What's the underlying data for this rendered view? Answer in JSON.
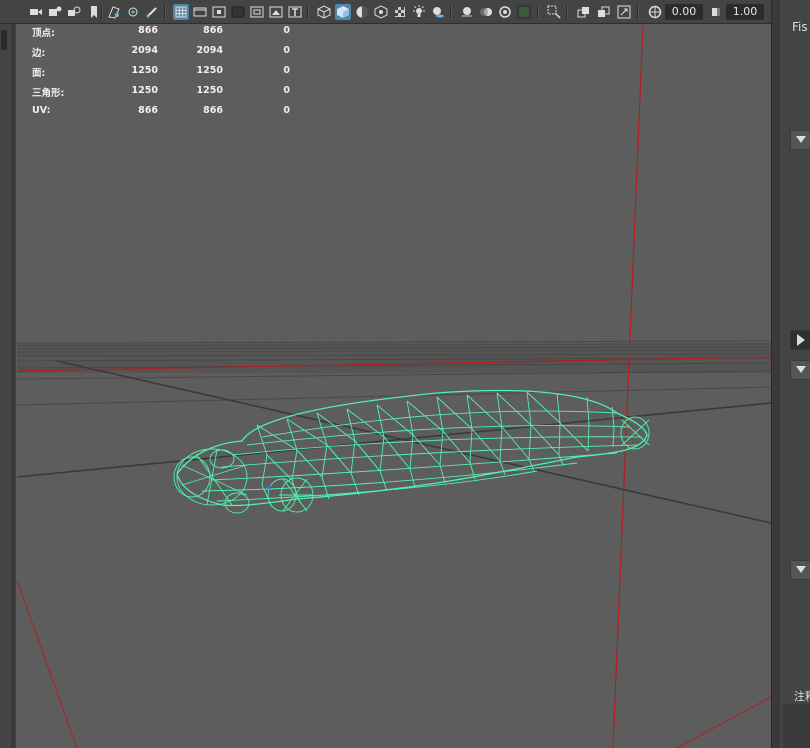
{
  "toolbar": {
    "icons": [
      "camera-icon",
      "camera-attr-icon",
      "bookmark-camera-icon",
      "bookmark-icon",
      "image-plane-icon",
      "grease-pencil-icon",
      "tool-icon",
      "grid-icon",
      "film-gate-icon",
      "resolution-gate-icon",
      "gate-mask-icon",
      "field-chart-icon",
      "safe-action-icon",
      "safe-title-icon",
      "wireframe-icon",
      "smooth-shade-icon",
      "default-material-icon",
      "xray-joint-icon",
      "textured-icon",
      "lighting-icon",
      "shadows-icon",
      "ambient-occlusion-icon",
      "motion-blur-icon",
      "anti-alias-icon",
      "depth-of-field-icon",
      "isolate-icon",
      "xray-icon",
      "xray-active-icon",
      "backface-icon",
      "exposure-icon",
      "gamma-icon"
    ],
    "exposure_value": "0.00",
    "gamma_value": "1.00"
  },
  "hud": {
    "rows": [
      {
        "label": "顶点:",
        "v1": "866",
        "v2": "866",
        "v3": "0"
      },
      {
        "label": "边:",
        "v1": "2094",
        "v2": "2094",
        "v3": "0"
      },
      {
        "label": "面:",
        "v1": "1250",
        "v2": "1250",
        "v3": "0"
      },
      {
        "label": "三角形:",
        "v1": "1250",
        "v2": "1250",
        "v3": "0"
      },
      {
        "label": "UV:",
        "v1": "866",
        "v2": "866",
        "v3": "0"
      }
    ]
  },
  "right_panel": {
    "tab_label": "Fis",
    "note_label": "注释"
  },
  "colors": {
    "viewport_bg": "#5d5d5d",
    "wireframe": "#52f0b0",
    "axis_red": "#b02020",
    "grid_dark": "#3a3a3a",
    "active_icon": "#5285a6"
  }
}
